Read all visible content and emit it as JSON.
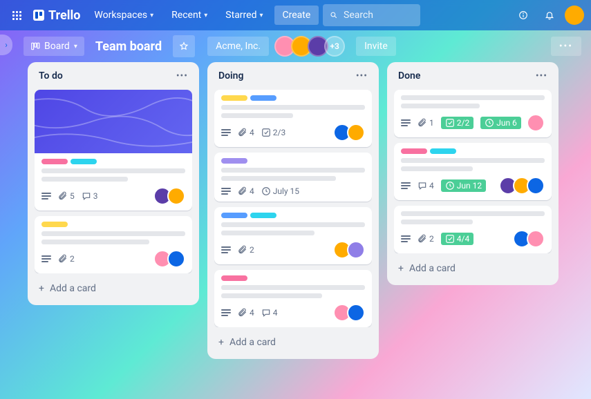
{
  "topbar": {
    "logo_text": "Trello",
    "nav": {
      "workspaces": "Workspaces",
      "recent": "Recent",
      "starred": "Starred"
    },
    "create": "Create",
    "search_placeholder": "Search"
  },
  "boardbar": {
    "view_label": "Board",
    "title": "Team board",
    "workspace": "Acme, Inc.",
    "member_overflow": "+3",
    "invite": "Invite"
  },
  "avatar_colors": {
    "user": "#ffab00",
    "m1": "#ff8fb1",
    "m2": "#ffab00",
    "m3": "#5b3da8",
    "m4": "#0c66e4",
    "m5": "#8f7ee7",
    "m6": "#ffab00"
  },
  "label_colors": {
    "pink": "#f871a0",
    "cyan": "#2dd4ee",
    "yellow": "#ffd84d",
    "blue": "#579dff",
    "purple": "#9f8fef"
  },
  "lists": [
    {
      "title": "To do",
      "add": "Add a card",
      "cards": [
        {
          "cover": true,
          "labels": [
            "pink",
            "cyan"
          ],
          "lines": [
            1.0,
            0.6
          ],
          "badges": {
            "desc": true,
            "attach": "5",
            "comments": "3"
          },
          "members": [
            "m3",
            "m6"
          ]
        },
        {
          "labels": [
            "yellow"
          ],
          "lines": [
            1.0,
            0.75
          ],
          "badges": {
            "desc": true,
            "attach": "2"
          },
          "members": [
            "m1",
            "m4"
          ]
        }
      ]
    },
    {
      "title": "Doing",
      "add": "Add a card",
      "cards": [
        {
          "labels": [
            "yellow",
            "blue"
          ],
          "lines": [
            1.0,
            0.5
          ],
          "badges": {
            "desc": true,
            "check": "2/3",
            "attach": "4"
          },
          "members": [
            "m4",
            "m6"
          ]
        },
        {
          "labels": [
            "purple"
          ],
          "lines": [
            1.0,
            0.8
          ],
          "badges": {
            "desc": true,
            "attach": "4",
            "due": "July 15"
          },
          "members": []
        },
        {
          "labels": [
            "blue",
            "cyan"
          ],
          "lines": [
            1.0,
            0.65
          ],
          "badges": {
            "desc": true,
            "attach": "2"
          },
          "members": [
            "m6",
            "m5"
          ]
        },
        {
          "labels": [
            "pink"
          ],
          "lines": [
            1.0,
            0.7
          ],
          "badges": {
            "desc": true,
            "attach": "4",
            "comments": "4"
          },
          "members": [
            "m1",
            "m4"
          ]
        }
      ]
    },
    {
      "title": "Done",
      "add": "Add a card",
      "cards": [
        {
          "lines": [
            1.0,
            0.55
          ],
          "badges": {
            "desc": true,
            "attach": "1",
            "check_done": "2/2",
            "due_done": "Jun 6"
          },
          "members": [
            "m1"
          ]
        },
        {
          "labels": [
            "pink",
            "cyan"
          ],
          "lines": [
            1.0,
            0.5
          ],
          "badges": {
            "desc": true,
            "comments": "4",
            "due_done": "Jun 12"
          },
          "members": [
            "m3",
            "m6",
            "m4"
          ]
        },
        {
          "lines": [
            1.0,
            0.5
          ],
          "badges": {
            "desc": true,
            "attach": "2",
            "check_done": "4/4"
          },
          "members": [
            "m4",
            "m1"
          ]
        }
      ]
    }
  ]
}
